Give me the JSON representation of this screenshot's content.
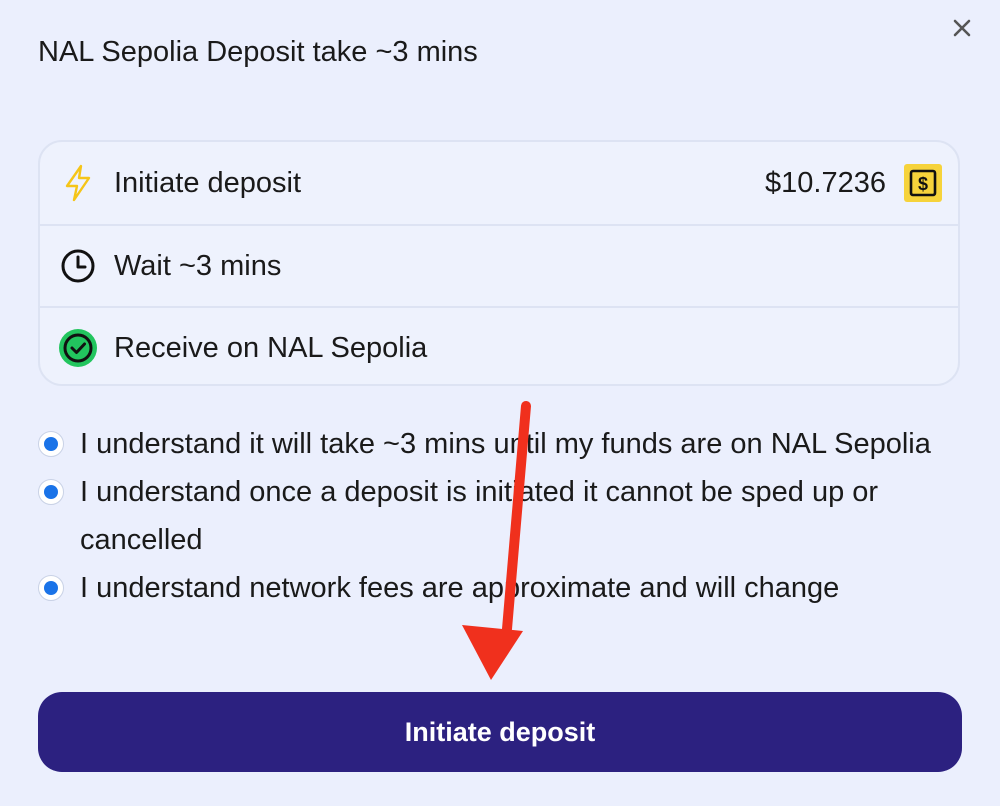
{
  "dialog": {
    "title": "NAL Sepolia Deposit take ~3 mins",
    "close_icon": "close-icon"
  },
  "steps": [
    {
      "icon": "lightning-icon",
      "label": "Initiate deposit",
      "amount": "$10.7236",
      "token_icon": "dollar-token-icon"
    },
    {
      "icon": "clock-icon",
      "label": "Wait ~3 mins"
    },
    {
      "icon": "check-circle-icon",
      "label": "Receive on NAL Sepolia"
    }
  ],
  "acknowledgements": [
    {
      "text": "I understand it will take ~3 mins until my funds are on NAL Sepolia",
      "checked": true
    },
    {
      "text": "I understand once a deposit is initiated it cannot be sped up or cancelled",
      "checked": true
    },
    {
      "text": "I understand network fees are approximate and will change",
      "checked": true
    }
  ],
  "cta": {
    "label": "Initiate deposit"
  },
  "colors": {
    "background": "#ebeffd",
    "primary_button": "#2c2180",
    "radio_checked": "#1a73e8",
    "lightning": "#f5c518",
    "success": "#22c55e",
    "token_badge": "#f6d33b",
    "annotation_arrow": "#f0301d"
  }
}
